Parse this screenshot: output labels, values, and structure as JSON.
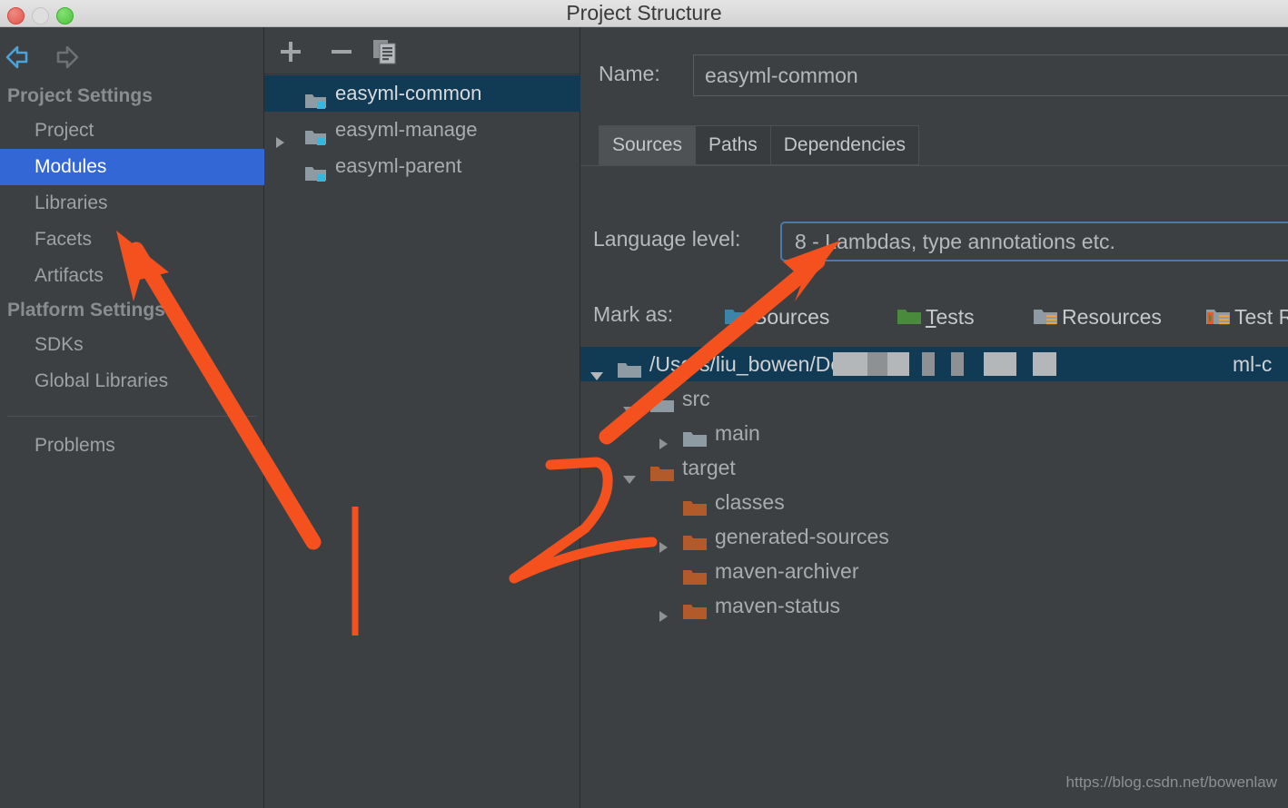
{
  "window": {
    "title": "Project Structure",
    "traffic_lights": [
      "close-red",
      "minimize-gray",
      "zoom-green"
    ]
  },
  "sidebar": {
    "nav_back_icon": "arrow-left-icon",
    "nav_forward_icon": "arrow-right-icon",
    "groups": [
      {
        "title": "Project Settings",
        "items": [
          {
            "label": "Project",
            "selected": false
          },
          {
            "label": "Modules",
            "selected": true
          },
          {
            "label": "Libraries",
            "selected": false
          },
          {
            "label": "Facets",
            "selected": false
          },
          {
            "label": "Artifacts",
            "selected": false
          }
        ]
      },
      {
        "title": "Platform Settings",
        "items": [
          {
            "label": "SDKs",
            "selected": false
          },
          {
            "label": "Global Libraries",
            "selected": false
          }
        ]
      }
    ],
    "bottom_item": {
      "label": "Problems",
      "selected": false
    },
    "selection_color": "#3367d6"
  },
  "modules_panel": {
    "toolbar": {
      "add_label": "+",
      "remove_label": "−",
      "copy_label": "copy"
    },
    "modules": [
      {
        "label": "easyml-common",
        "selected": true,
        "expandable": false
      },
      {
        "label": "easyml-manage",
        "selected": false,
        "expandable": true
      },
      {
        "label": "easyml-parent",
        "selected": false,
        "expandable": false
      }
    ]
  },
  "detail": {
    "name_label": "Name:",
    "name_value": "easyml-common",
    "tabs": [
      {
        "label": "Sources",
        "active": true
      },
      {
        "label": "Paths",
        "active": false
      },
      {
        "label": "Dependencies",
        "active": false
      }
    ],
    "language_level_label": "Language level:",
    "language_level_value": "8 - Lambdas, type annotations etc.",
    "mark_as_label": "Mark as:",
    "mark_as_buttons": [
      {
        "label": "Sources",
        "icon": "folder-blue-icon",
        "mnemonic": ""
      },
      {
        "label": "Tests",
        "icon": "folder-green-icon",
        "mnemonic": "T"
      },
      {
        "label": "Resources",
        "icon": "folder-resources-icon",
        "mnemonic": ""
      },
      {
        "label": "Test Reso",
        "icon": "folder-test-resources-icon",
        "mnemonic": ""
      }
    ],
    "tree": [
      {
        "label": "/Users/liu_bowen/Desktop,",
        "tail": "ml-c",
        "indent": 0,
        "twisty": "down",
        "icon": "folder-gray-icon",
        "selected": true,
        "redacted": true
      },
      {
        "label": "src",
        "indent": 1,
        "twisty": "down",
        "icon": "folder-gray-icon",
        "selected": false
      },
      {
        "label": "main",
        "indent": 2,
        "twisty": "right",
        "icon": "folder-gray-icon",
        "selected": false
      },
      {
        "label": "target",
        "indent": 1,
        "twisty": "down",
        "icon": "folder-orange-icon",
        "selected": false
      },
      {
        "label": "classes",
        "indent": 2,
        "twisty": "none",
        "icon": "folder-orange-icon",
        "selected": false
      },
      {
        "label": "generated-sources",
        "indent": 2,
        "twisty": "right",
        "icon": "folder-orange-icon",
        "selected": false
      },
      {
        "label": "maven-archiver",
        "indent": 2,
        "twisty": "none",
        "icon": "folder-orange-icon",
        "selected": false
      },
      {
        "label": "maven-status",
        "indent": 2,
        "twisty": "right",
        "icon": "folder-orange-icon",
        "selected": false
      }
    ]
  },
  "annotations": {
    "color": "#f4511e",
    "marks": [
      {
        "type": "arrow",
        "name": "arrow-to-libraries"
      },
      {
        "type": "arrow",
        "name": "arrow-to-language-level"
      },
      {
        "type": "digit",
        "name": "handwritten-two",
        "value": "2"
      },
      {
        "type": "line",
        "name": "vertical-bar"
      }
    ]
  },
  "watermark": "https://blog.csdn.net/bowenlaw"
}
